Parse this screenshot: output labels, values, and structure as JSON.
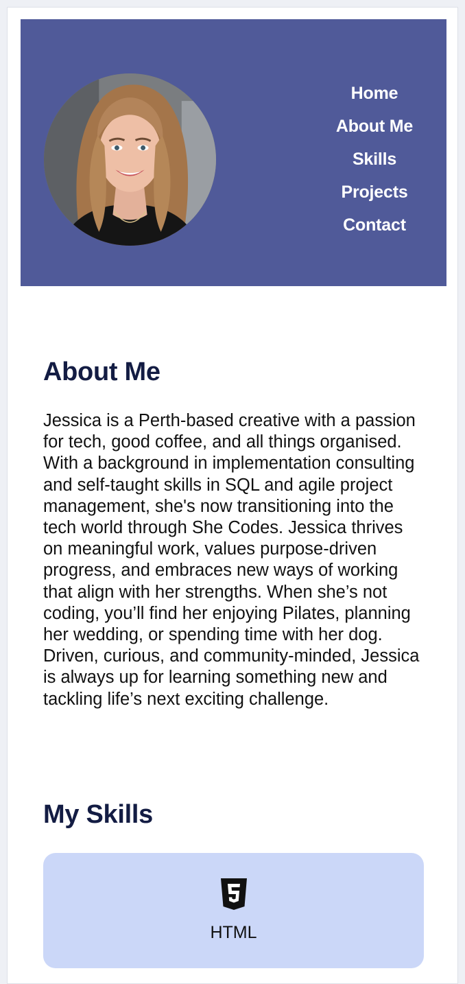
{
  "nav": {
    "items": [
      {
        "label": "Home"
      },
      {
        "label": "About Me"
      },
      {
        "label": "Skills"
      },
      {
        "label": "Projects"
      },
      {
        "label": "Contact"
      }
    ]
  },
  "about": {
    "title": "About Me",
    "body": "Jessica is a Perth-based creative with a passion for tech, good coffee, and all things organised. With a background in implementation consulting and self-taught skills in SQL and agile project management, she's now transitioning into the tech world through She Codes. Jessica thrives on meaningful work, values purpose-driven progress, and embraces new ways of working that align with her strengths. When she’s not coding, you’ll find her enjoying Pilates, planning her wedding, or spending time with her dog. Driven, curious, and community-minded, Jessica is always up for learning something new and tackling life’s next exciting challenge."
  },
  "skills": {
    "title": "My Skills",
    "items": [
      {
        "label": "HTML",
        "icon": "html5-icon"
      }
    ]
  },
  "colors": {
    "hero_bg": "#505a99",
    "heading": "#131c43",
    "skill_card_bg": "#cbd7f8"
  }
}
